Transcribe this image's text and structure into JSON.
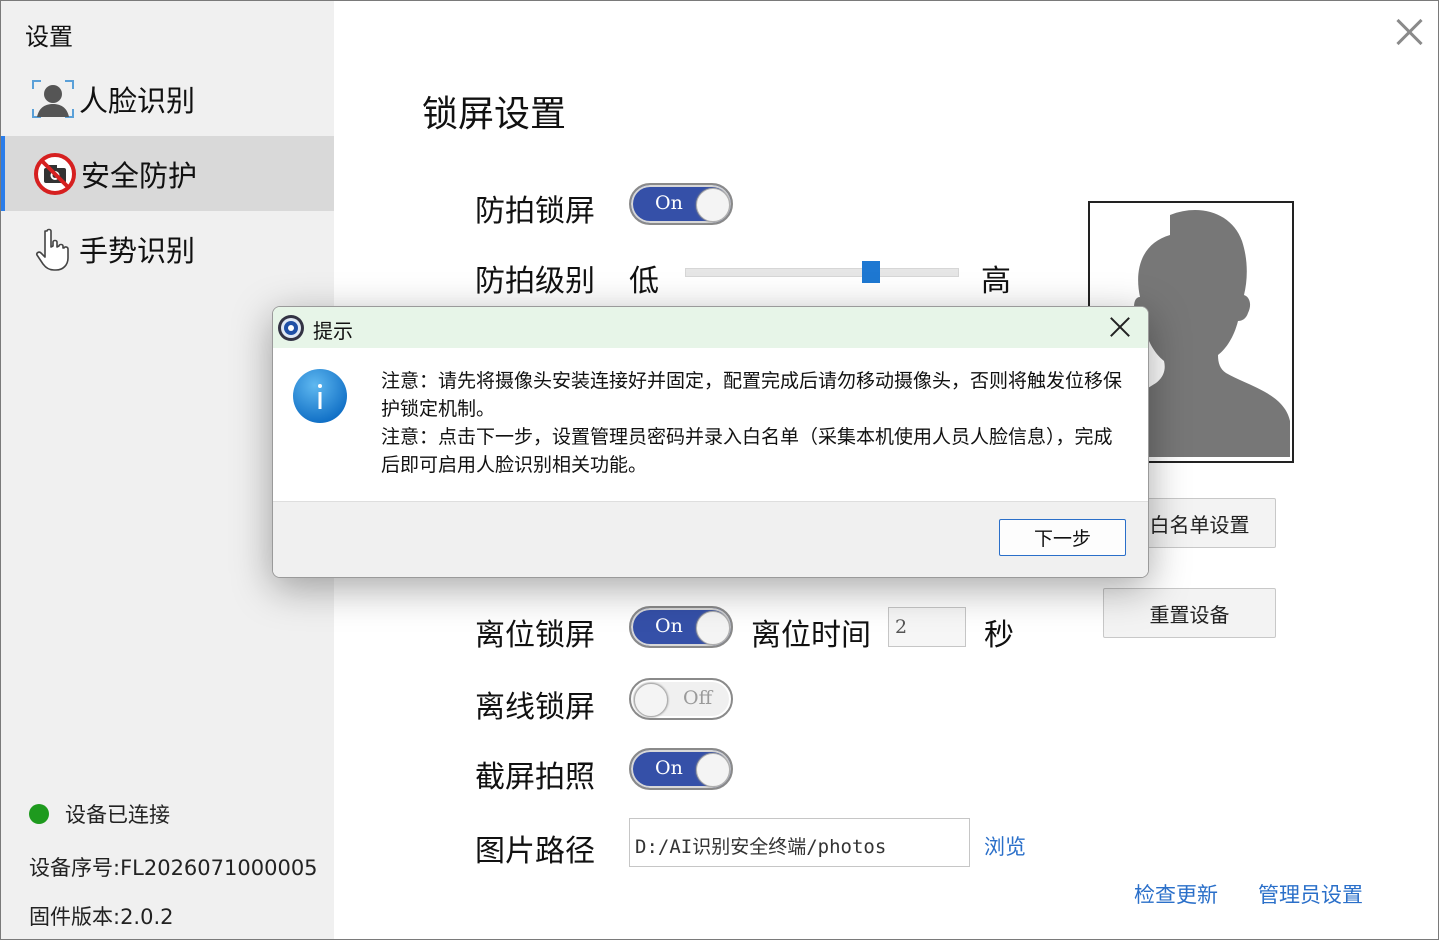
{
  "app": {
    "title": "设置"
  },
  "sidebar": {
    "items": [
      {
        "label": "人脸识别",
        "icon": "face-id-icon"
      },
      {
        "label": "安全防护",
        "icon": "no-camera-icon"
      },
      {
        "label": "手势识别",
        "icon": "hand-pointer-icon"
      }
    ],
    "active_index": 1,
    "status": {
      "text": "设备已连接",
      "color": "#1e9a1e"
    },
    "serial": "设备序号:FL2026071000005",
    "firmware": "固件版本:2.0.2"
  },
  "main": {
    "title": "锁屏设置",
    "anti_photo": {
      "label": "防拍锁屏",
      "toggle": "On"
    },
    "level": {
      "label": "防拍级别",
      "low": "低",
      "high": "高",
      "value_fraction": 0.68
    },
    "whitelist_button": "须白名单设置",
    "reset_button": "重置设备",
    "away_lock": {
      "label": "离位锁屏",
      "toggle": "On",
      "time_label": "离位时间",
      "time_value": "2",
      "unit": "秒"
    },
    "offline_lock": {
      "label": "离线锁屏",
      "toggle": "Off"
    },
    "screenshot_photo": {
      "label": "截屏拍照",
      "toggle": "On"
    },
    "photo_path": {
      "label": "图片路径",
      "value": "D:/AI识别安全终端/photos",
      "browse": "浏览"
    },
    "check_update": "检查更新",
    "admin_settings": "管理员设置"
  },
  "dialog": {
    "title": "提示",
    "lines": [
      "注意：请先将摄像头安装连接好并固定，配置完成后请勿移动摄像头，否则将触发位移保护锁定机制。",
      "注意：点击下一步，设置管理员密码并录入白名单（采集本机使用人员人脸信息），完成后即可启用人脸识别相关功能。"
    ],
    "next_button": "下一步",
    "icon": "info-icon"
  },
  "colors": {
    "accent": "#2b7de9",
    "toggle_on": "#3550a8",
    "link": "#2a6fc9",
    "dialog_title_bg": "#e7f5e8"
  }
}
